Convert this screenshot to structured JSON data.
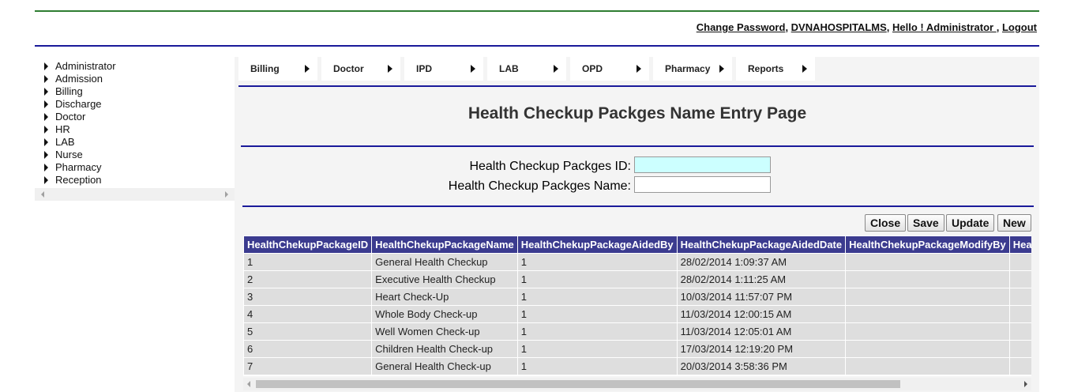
{
  "header": {
    "change_password": "Change Password",
    "sep1": ", ",
    "username": "DVNAHOSPITALMS",
    "sep2": ", ",
    "greeting": "Hello ! Administrator ",
    "sep3": ", ",
    "logout": "Logout"
  },
  "sidebar": {
    "items": [
      {
        "label": "Administrator"
      },
      {
        "label": "Admission"
      },
      {
        "label": "Billing"
      },
      {
        "label": "Discharge"
      },
      {
        "label": "Doctor"
      },
      {
        "label": "HR"
      },
      {
        "label": "LAB"
      },
      {
        "label": "Nurse"
      },
      {
        "label": "Pharmacy"
      },
      {
        "label": "Reception"
      }
    ]
  },
  "menu": {
    "items": [
      {
        "label": "Billing"
      },
      {
        "label": "Doctor"
      },
      {
        "label": "IPD"
      },
      {
        "label": "LAB"
      },
      {
        "label": "OPD"
      },
      {
        "label": "Pharmacy"
      },
      {
        "label": "Reports"
      }
    ]
  },
  "page": {
    "title": "Health Checkup Packges Name Entry Page"
  },
  "form": {
    "id_label": "Health Checkup Packges ID:",
    "id_value": "",
    "name_label": "Health Checkup Packges Name:",
    "name_value": ""
  },
  "buttons": {
    "close": "Close",
    "save": "Save",
    "update": "Update",
    "new": "New"
  },
  "grid": {
    "columns": [
      "HealthChekupPackageID",
      "HealthChekupPackageName",
      "HealthChekupPackageAidedBy",
      "HealthChekupPackageAidedDate",
      "HealthChekupPackageModifyBy",
      "HealthChekupPackageModifyDate"
    ],
    "rows": [
      [
        "1",
        "General Health Checkup",
        "1",
        "28/02/2014 1:09:37 AM",
        "",
        ""
      ],
      [
        "2",
        "Executive Health Checkup",
        "1",
        "28/02/2014 1:11:25 AM",
        "",
        ""
      ],
      [
        "3",
        "Heart Check-Up",
        "1",
        "10/03/2014 11:57:07 PM",
        "",
        ""
      ],
      [
        "4",
        "Whole Body Check-up",
        "1",
        "11/03/2014 12:00:15 AM",
        "",
        ""
      ],
      [
        "5",
        "Well Women Check-up",
        "1",
        "11/03/2014 12:05:01 AM",
        "",
        ""
      ],
      [
        "6",
        "Children Health Check-up",
        "1",
        "17/03/2014 12:19:20 PM",
        "",
        ""
      ],
      [
        "7",
        "General Health Check-up",
        "1",
        "20/03/2014 3:58:36 PM",
        "",
        ""
      ]
    ]
  },
  "colors": {
    "header_bg": "#3b3b8f",
    "row_bg": "#dedede",
    "rule_blue": "#1a1a9a",
    "rule_green": "#2e7d32",
    "id_input_bg": "#ccffff"
  }
}
